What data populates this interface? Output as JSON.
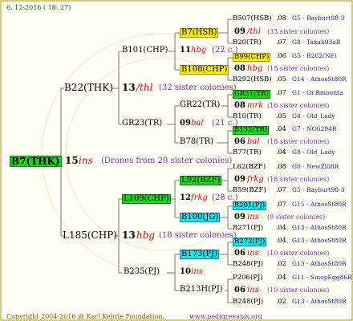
{
  "date": "6. 12-2016 ( 18: 27)",
  "root": {
    "label": "B7(THK)",
    "year": "15",
    "line": "ins",
    "drones": "(Drones from 20 sister colonies)"
  },
  "p1": {
    "label": "B22(THK)",
    "year": "13",
    "line": "/thl",
    "sisters": "(32 sister colonies)"
  },
  "p2": {
    "label": "L185(CHP)",
    "year": "13",
    "line": "hbg",
    "sisters": "(18 sister colonies)"
  },
  "g1": {
    "label": "B101(CHP)",
    "year": "11",
    "line": "hbg",
    "sisters": "(22 c.)"
  },
  "g2": {
    "label": "GR23(TR)",
    "year": "09",
    "line": "bal",
    "sisters": "(21 c.)"
  },
  "g3": {
    "label": "L109(CHP)",
    "year": "12",
    "line": "frkg",
    "sisters": "(28 c.)"
  },
  "g4": {
    "label": "B235(PJ)",
    "year": "10",
    "line": "ins",
    "sisters": ""
  },
  "gg1": {
    "label": "B7(HSB)"
  },
  "gg2": {
    "label": "B108(CHP)"
  },
  "gg3": {
    "label": "GR22(TR)"
  },
  "gg4": {
    "label": "B78(TR)"
  },
  "gg5": {
    "label": "L92(BZF)"
  },
  "gg6": {
    "label": "B100(JG)"
  },
  "gg7": {
    "label": "B173(PJ)"
  },
  "gg8": {
    "label": "B213H(PJ)"
  },
  "right": [
    {
      "a": "B507(HSB)",
      "yr": ".08",
      "info": "G5 - Bayburt98-3"
    },
    {
      "a": "09",
      "ln": "/thl",
      "info": "(33 sister colonies)"
    },
    {
      "a": "B20(TR)",
      "yr": ".07",
      "info": "G8 - Takab93aR"
    },
    {
      "a": "B99(CHP)",
      "yr": ".06",
      "info": "G5 - B262(NE)"
    },
    {
      "a": "08",
      "ln": "hbg",
      "info": "(15 sister colonies)"
    },
    {
      "a": "B292(HSB)",
      "yr": ".05",
      "info": "G14 - AthosSt80R"
    },
    {
      "a": "GR51(TR)",
      "yr": ".07",
      "info": "G1 - Gr.Rmounta"
    },
    {
      "a": "08",
      "ln": "mrk",
      "info": "(16 sister colonies)"
    },
    {
      "a": "B10(TR)",
      "yr": ".05",
      "info": "G8 - Old_Lady"
    },
    {
      "a": "B132(TR)",
      "yr": ".04",
      "info": "G7 - NO6294R"
    },
    {
      "a": "06",
      "ln": "bal",
      "info": "(18 sister colonies)"
    },
    {
      "a": "B77(TR)",
      "yr": ".04",
      "info": "G8 - Old_Lady"
    },
    {
      "a": "L62(BZF)",
      "yr": ".08",
      "info": "G0 - NewZl08R"
    },
    {
      "a": "09",
      "ln": "frkg",
      "info": "(18 sister colonies)"
    },
    {
      "a": "B59(BZF)",
      "yr": ".07",
      "info": "G5 - Bayburt98-3"
    },
    {
      "a": "B201(PJ)",
      "yr": ".07",
      "info": "G15 - AthosSt80R"
    },
    {
      "a": "09",
      "ln": "ins",
      "info": "(9 sister colonies)"
    },
    {
      "a": "B271(PJ)",
      "yr": ".04",
      "info": "G13 - AthosSt80R"
    },
    {
      "a": "B273(PJ)",
      "yr": ".04",
      "info": "G13 - AthosSt80R"
    },
    {
      "a": "06",
      "ln": "ins",
      "info": "(10 sister colonies)"
    },
    {
      "a": "B248(PJ)",
      "yr": ".02",
      "info": "G13 - AthosSt80R"
    },
    {
      "a": "P206(PJ)",
      "yr": ".04",
      "info": "G11 - SinopEgg86R"
    },
    {
      "a": "06",
      "ln": "ins",
      "info": "(10 sister colonies)"
    },
    {
      "a": "B248(PJ)",
      "yr": ".02",
      "info": "G13 - AthosSt80R"
    }
  ],
  "footer": {
    "copy": "Copyright 2004-2016 @ Karl Kehrle Foundation.",
    "url": "www.pedigreeapis.org"
  }
}
